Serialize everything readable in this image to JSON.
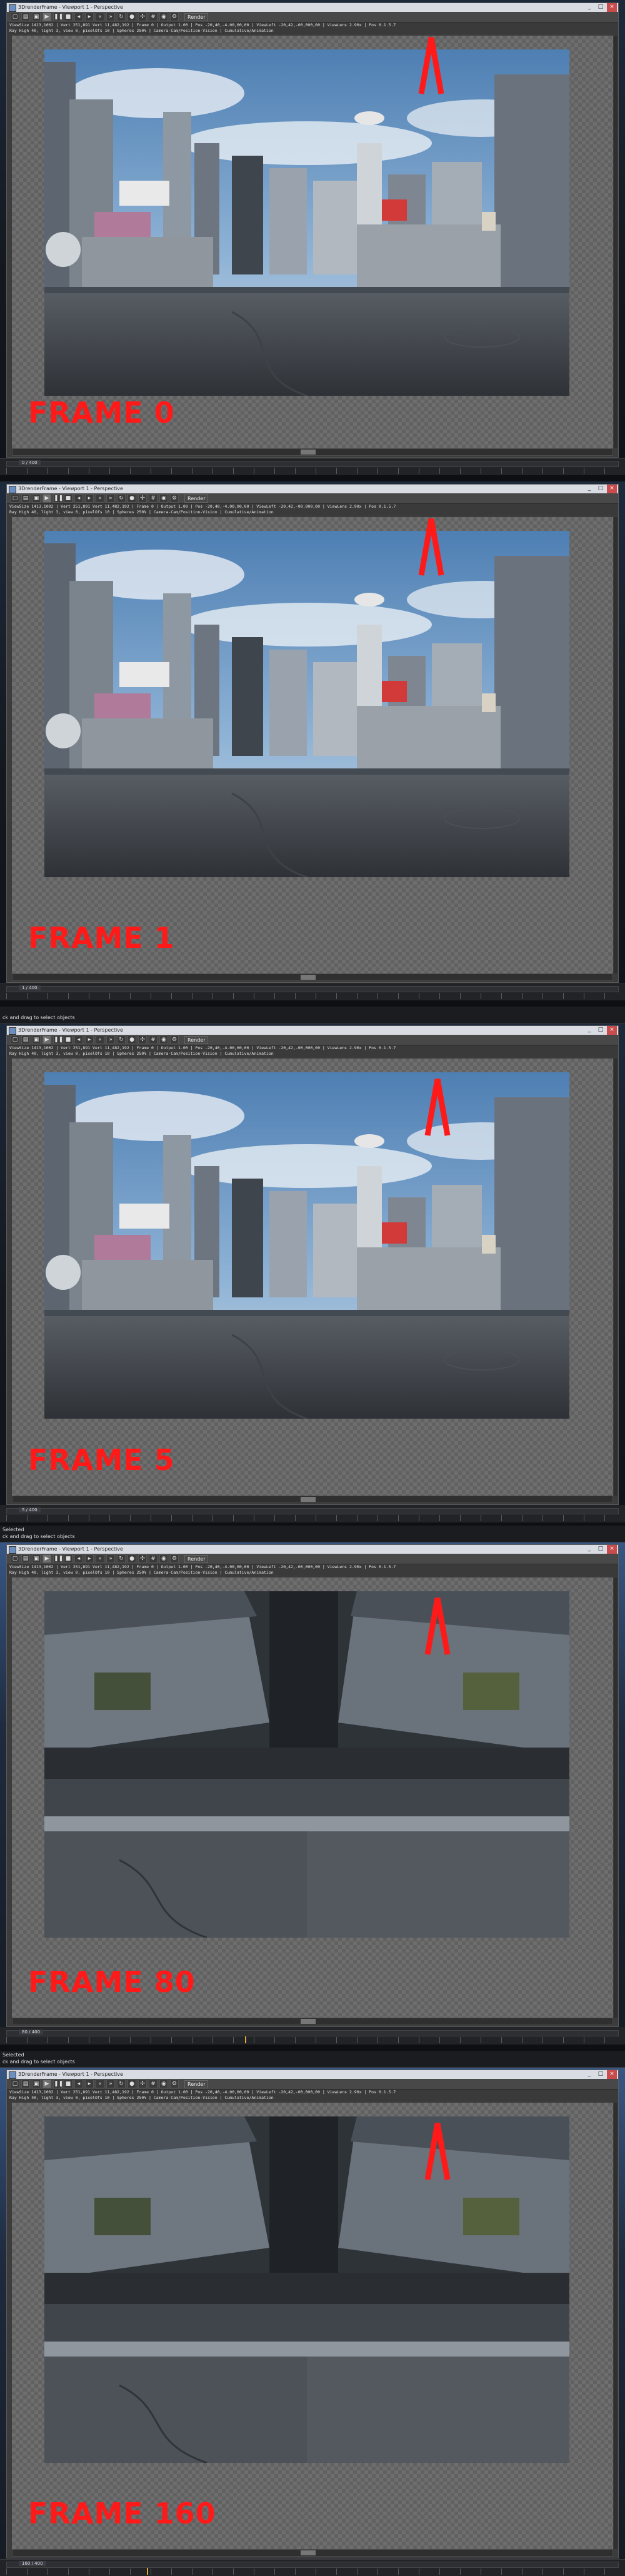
{
  "app": {
    "title": "3DrenderFrame - Viewport 1 - Perspective",
    "toolbar_view_label": "Render",
    "status_line_1": "ViewSize 1413,1002 | Vert 251,891 Vert 11,482,192 | Frame 0 | Output 1.00 | Pos -20,40,-4.00,00,00 | ViewLeft -20,42,-00,000,00 | ViewLens 2.90x | Pos 0.1.5.7",
    "status_line_2": "Ray High 40, light 3, view 0, pixelOfs 10 | Spheres 250% | Camera-Cam/Position-Vision | Cumulative/Animation"
  },
  "icons": [
    "new-icon",
    "open-icon",
    "save-icon",
    "play-icon",
    "pause-icon",
    "stop-icon",
    "prev-icon",
    "next-icon",
    "rewind-icon",
    "forward-icon",
    "loop-icon",
    "record-icon",
    "snap-icon",
    "grid-icon",
    "camera-icon",
    "gear-icon"
  ],
  "colors": {
    "frame_label": "#ff1a1a",
    "annotation_arrow": "#ff1a1a"
  },
  "panels": [
    {
      "frame_label": "FRAME 0",
      "timeline_counter": "0 / 400",
      "prebar_text": "",
      "timeline_hint": ""
    },
    {
      "frame_label": "FRAME 1",
      "timeline_counter": "1 / 400",
      "prebar_text": "",
      "timeline_hint": ""
    },
    {
      "frame_label": "FRAME 5",
      "timeline_counter": "5 / 400",
      "prebar_text": "ck and drag to select objects",
      "timeline_hint": ""
    },
    {
      "frame_label": "FRAME 80",
      "timeline_counter": "80 / 400",
      "prebar_text": "ck and drag to select objects",
      "timeline_hint": "Selected"
    },
    {
      "frame_label": "FRAME 160",
      "timeline_counter": "160 / 400",
      "prebar_text": "ck and drag to select objects",
      "timeline_hint": "Selected"
    }
  ]
}
